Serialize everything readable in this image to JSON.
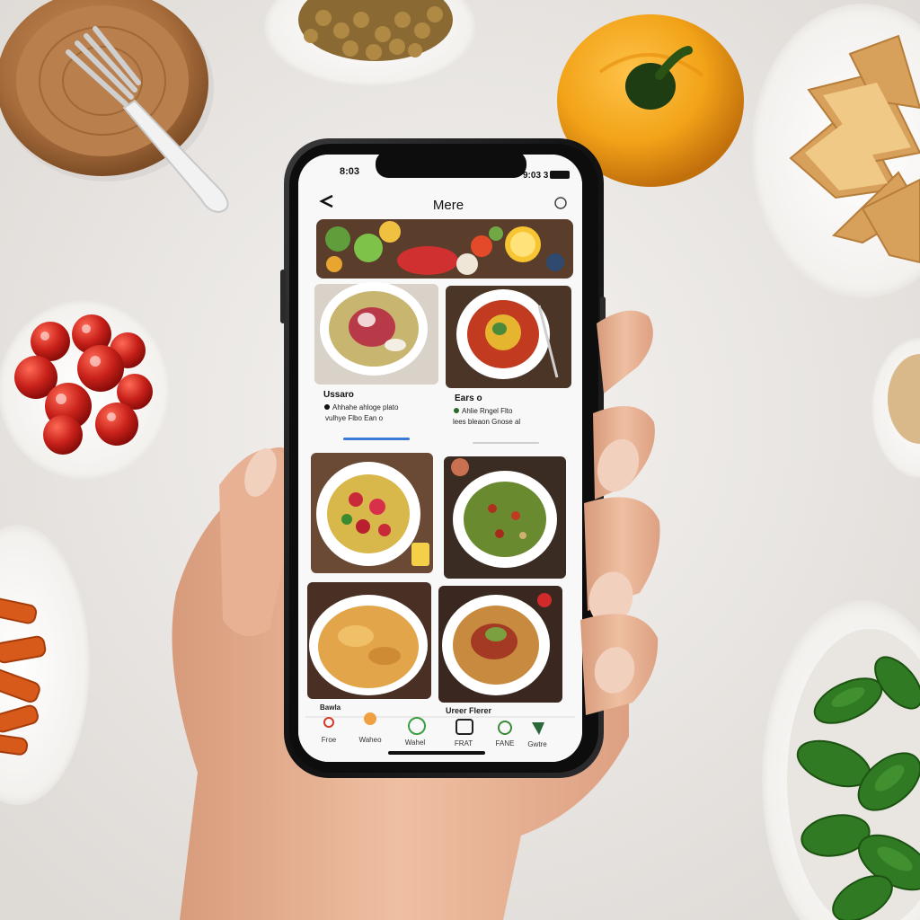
{
  "status_bar": {
    "time": "8:03",
    "right": "9:03 3"
  },
  "header": {
    "title": "Mere"
  },
  "cards": [
    {
      "title": "Ussaro",
      "line1": "Ahhahe ahloge plato",
      "line2": "vulhye Flbo Ean o"
    },
    {
      "title": "Ears o",
      "line1": "Ahlie Rngel Flto",
      "line2": "lees bleaon Gnose al"
    }
  ],
  "bottom_labels": {
    "left": "Bawla",
    "right": "Ureer Flerer"
  },
  "tabs": [
    {
      "label": "Froe"
    },
    {
      "label": "Waheo"
    },
    {
      "label": "Wahel"
    },
    {
      "label": "FRAT"
    },
    {
      "label": "FANE"
    },
    {
      "label": "Gwtre"
    }
  ],
  "colors": {
    "background": "#ece9e6",
    "phone_frame": "#141414",
    "screen": "#f7f7f7",
    "accent": "#3a7bd5",
    "tomato": "#c8211a",
    "pepper": "#f2a318"
  }
}
